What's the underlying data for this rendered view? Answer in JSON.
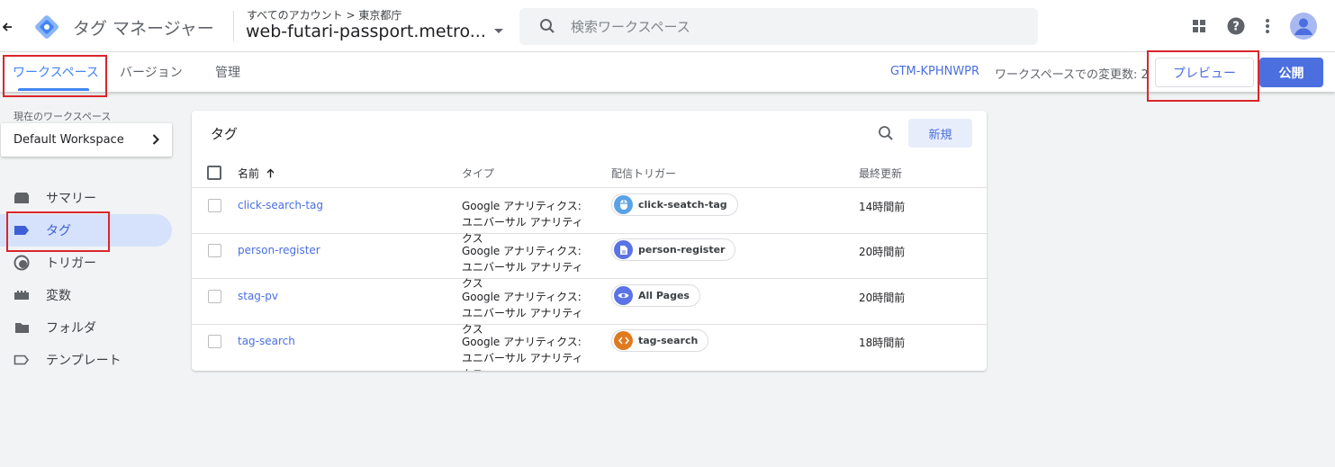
{
  "header": {
    "product_name": "タグ マネージャー",
    "breadcrumb": "すべてのアカウント > 東京都庁",
    "container_name": "web-futari-passport.metro....",
    "search_placeholder": "検索ワークスペース"
  },
  "subnav": {
    "tabs": [
      {
        "label": "ワークスペース",
        "active": true
      },
      {
        "label": "バージョン",
        "active": false
      },
      {
        "label": "管理",
        "active": false
      }
    ],
    "container_id": "GTM-KPHNWPR",
    "workspace_changes": "ワークスペースでの変更数: 2",
    "preview_label": "プレビュー",
    "publish_label": "公開"
  },
  "sidebar": {
    "workspace_label": "現在のワークスペース",
    "workspace_name": "Default Workspace",
    "items": [
      {
        "label": "サマリー",
        "icon": "summary-icon",
        "active": false
      },
      {
        "label": "タグ",
        "icon": "tag-icon",
        "active": true
      },
      {
        "label": "トリガー",
        "icon": "trigger-icon",
        "active": false
      },
      {
        "label": "変数",
        "icon": "variable-icon",
        "active": false
      },
      {
        "label": "フォルダ",
        "icon": "folder-icon",
        "active": false
      },
      {
        "label": "テンプレート",
        "icon": "template-icon",
        "active": false
      }
    ]
  },
  "tags_table": {
    "title": "タグ",
    "new_label": "新規",
    "columns": {
      "name": "名前",
      "type": "タイプ",
      "trigger": "配信トリガー",
      "updated": "最終更新"
    },
    "rows": [
      {
        "name": "click-search-tag",
        "type": "Google アナリティクス: ユニバーサル アナリティクス",
        "trigger": "click-seatch-tag",
        "trigger_icon": "click-icon",
        "trigger_color": "#5aa2e6",
        "updated": "14時間前"
      },
      {
        "name": "person-register",
        "type": "Google アナリティクス: ユニバーサル アナリティクス",
        "trigger": "person-register",
        "trigger_icon": "document-icon",
        "trigger_color": "#5a73e6",
        "updated": "20時間前"
      },
      {
        "name": "stag-pv",
        "type": "Google アナリティクス: ユニバーサル アナリティクス",
        "trigger": "All Pages",
        "trigger_icon": "eye-icon",
        "trigger_color": "#5a73e6",
        "updated": "20時間前"
      },
      {
        "name": "tag-search",
        "type": "Google アナリティクス: ユニバーサル アナリティクス",
        "trigger": "tag-search",
        "trigger_icon": "code-icon",
        "trigger_color": "#e07a1f",
        "updated": "18時間前"
      }
    ]
  },
  "colors": {
    "accent": "#4a6ee0",
    "highlight": "#d9262c",
    "active_nav": "#d6e2fb"
  }
}
